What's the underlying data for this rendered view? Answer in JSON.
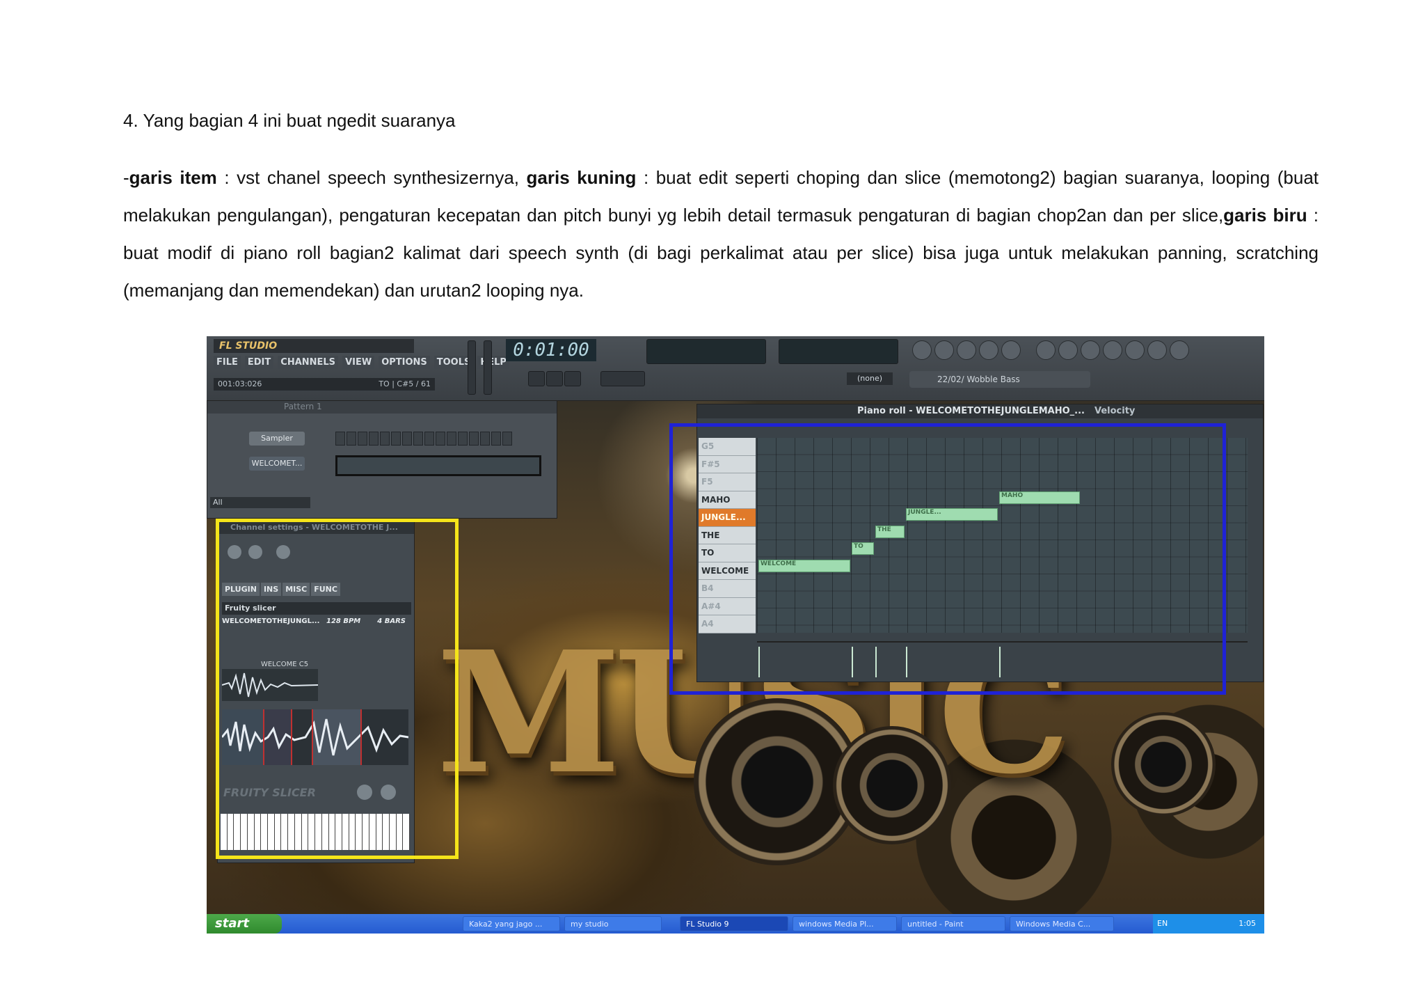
{
  "doc": {
    "heading": "4. Yang bagian 4 ini buat ngedit suaranya",
    "p_dash": "-",
    "p_b1": "garis item",
    "p_t1": " : vst chanel speech synthesizernya, ",
    "p_b2": "garis kuning",
    "p_t2": " : buat edit seperti choping dan slice (memotong2) bagian suaranya, looping (buat melakukan pengulangan), pengaturan kecepatan dan pitch  bunyi yg lebih detail termasuk pengaturan di bagian chop2an dan per slice,",
    "p_b3": "garis biru",
    "p_t3": " : buat modif di piano roll bagian2 kalimat dari speech synth (di bagi perkalimat atau per slice) bisa juga untuk melakukan panning, scratching (memanjang dan memendekan) dan urutan2 looping nya."
  },
  "fl": {
    "logo": "FL STUDIO",
    "menu": [
      "FILE",
      "EDIT",
      "CHANNELS",
      "VIEW",
      "OPTIONS",
      "TOOLS",
      "HELP"
    ],
    "status_left": "001:03:026",
    "status_right": "TO | C#5 / 61",
    "time": "0:01:00",
    "tempo_select": "(none)",
    "preset": "22/02/ Wobble Bass",
    "pattern": "Pattern 1",
    "channel_sampler": "Sampler",
    "channel_welcome": "WELCOMET...",
    "filter_all": "All",
    "background_word": "MUSIC"
  },
  "channel_settings": {
    "title": "Channel settings - WELCOMETOTHE J...",
    "tabs": [
      "PLUGIN",
      "INS",
      "MISC",
      "FUNC"
    ],
    "plugin": "Fruity slicer",
    "sample": "WELCOMETOTHEJUNGL...",
    "bpm": "128 BPM",
    "bars": "4 BARS",
    "slice_label": "WELCOME  C5",
    "brand": "FRUITY SLICER"
  },
  "piano_roll": {
    "title": "Piano roll - WELCOMETOTHEJUNGLEMAHO_...",
    "mode": "Velocity",
    "keys": [
      {
        "label": "G5",
        "dim": true
      },
      {
        "label": "F#5",
        "dim": true
      },
      {
        "label": "F5",
        "dim": true
      },
      {
        "label": "MAHO",
        "dim": false
      },
      {
        "label": "JUNGLE...",
        "dim": false,
        "selected": true
      },
      {
        "label": "THE",
        "dim": false
      },
      {
        "label": "TO",
        "dim": false
      },
      {
        "label": "WELCOME",
        "dim": false
      },
      {
        "label": "B4",
        "dim": true
      },
      {
        "label": "A#4",
        "dim": true
      },
      {
        "label": "A4",
        "dim": true
      }
    ],
    "notes": [
      "WELCOME",
      "TO",
      "THE",
      "JUNGLE...",
      "MAHO"
    ]
  },
  "taskbar": {
    "start": "start",
    "tasks": [
      "Kaka2 yang jago ...",
      "my studio",
      "FL Studio 9",
      "windows Media Pl...",
      "untitled - Paint",
      "Windows Media C..."
    ],
    "lang": "EN",
    "clock": "1:05"
  },
  "colors": {
    "yellow_box": "#f5e41a",
    "blue_box": "#1f22d6",
    "note": "#9fdcb0"
  }
}
